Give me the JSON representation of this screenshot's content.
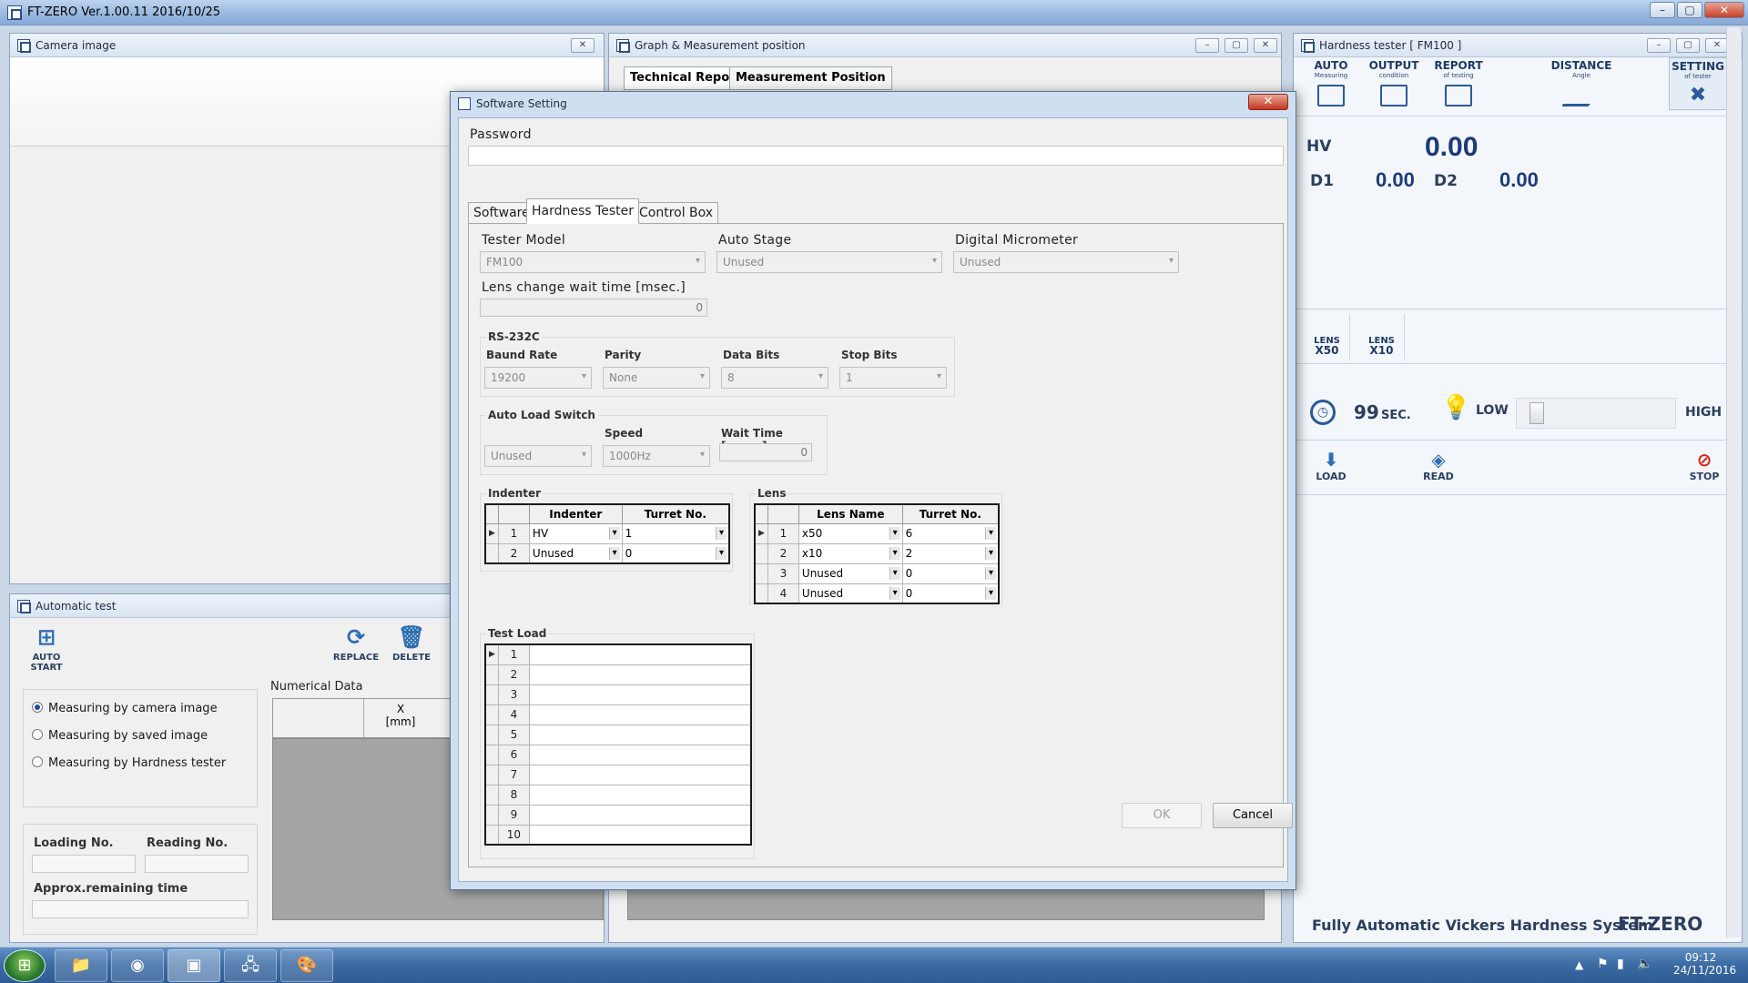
{
  "window": {
    "title": "FT-ZERO Ver.1.00.11  2016/10/25"
  },
  "camera_panel": {
    "title": "Camera image"
  },
  "auto_panel": {
    "title": "Automatic test",
    "buttons": {
      "auto_start": "AUTO\nSTART",
      "replace": "REPLACE",
      "delete": "DELETE"
    },
    "auto_start_line1": "AUTO",
    "auto_start_line2": "START",
    "modes": [
      "Measuring by camera image",
      "Measuring by saved image",
      "Measuring by Hardness tester"
    ],
    "loading_no": "Loading No.",
    "reading_no": "Reading No.",
    "remaining_time": "Approx.remaining time",
    "numerical_data": "Numerical Data",
    "col_x": "X",
    "col_x_unit": "[mm]"
  },
  "graph_panel": {
    "title": "Graph & Measurement position",
    "tabs": [
      "Technical Report",
      "Measurement Position"
    ]
  },
  "hardness_panel": {
    "title": "Hardness tester [ FM100 ]",
    "buttons": [
      {
        "main": "AUTO",
        "sub": "Measuring"
      },
      {
        "main": "OUTPUT",
        "sub": "condition"
      },
      {
        "main": "REPORT",
        "sub": "of testing"
      },
      {
        "main": "DISTANCE",
        "sub": "Angle"
      },
      {
        "main": "SETTING",
        "sub": "of tester"
      }
    ],
    "hv_label": "HV",
    "hv_value": "0.00",
    "d1_label": "D1",
    "d1_value": "0.00",
    "d2_label": "D2",
    "d2_value": "0.00",
    "lenses": [
      {
        "top": "LENS",
        "bottom": "X50"
      },
      {
        "top": "LENS",
        "bottom": "X10"
      }
    ],
    "timer_value": "99",
    "timer_unit": "SEC.",
    "light_low": "LOW",
    "light_high": "HIGH",
    "actions": {
      "load": "LOAD",
      "read": "READ",
      "stop": "STOP"
    },
    "footer": "Fully Automatic Vickers Hardness System",
    "brand": "FT-ZERO"
  },
  "dialog": {
    "title": "Software Setting",
    "password_label": "Password",
    "password_value": "",
    "tabs": [
      "Software",
      "Hardness Tester",
      "Control Box"
    ],
    "tester_model_label": "Tester Model",
    "tester_model": "FM100",
    "auto_stage_label": "Auto Stage",
    "auto_stage": "Unused",
    "micrometer_label": "Digital Micrometer",
    "micrometer": "Unused",
    "lens_wait_label": "Lens change wait time [msec.]",
    "lens_wait_value": "0",
    "rs232c": {
      "legend": "RS-232C",
      "baud_label": "Baund Rate",
      "baud": "19200",
      "parity_label": "Parity",
      "parity": "None",
      "databits_label": "Data Bits",
      "databits": "8",
      "stopbits_label": "Stop Bits",
      "stopbits": "1"
    },
    "auto_load": {
      "legend": "Auto Load Switch",
      "value": "Unused",
      "speed_label": "Speed",
      "speed": "1000Hz",
      "wait_label": "Wait Time [msec.]",
      "wait": "0"
    },
    "indenter": {
      "legend": "Indenter",
      "headers": [
        "Indenter",
        "Turret No."
      ],
      "rows": [
        {
          "no": "1",
          "name": "HV",
          "turret": "1"
        },
        {
          "no": "2",
          "name": "Unused",
          "turret": "0"
        }
      ]
    },
    "lens": {
      "legend": "Lens",
      "headers": [
        "Lens Name",
        "Turret No."
      ],
      "rows": [
        {
          "no": "1",
          "name": "x50",
          "turret": "6"
        },
        {
          "no": "2",
          "name": "x10",
          "turret": "2"
        },
        {
          "no": "3",
          "name": "Unused",
          "turret": "0"
        },
        {
          "no": "4",
          "name": "Unused",
          "turret": "0"
        }
      ]
    },
    "test_load": {
      "legend": "Test Load",
      "rows": [
        "1",
        "2",
        "3",
        "4",
        "5",
        "6",
        "7",
        "8",
        "9",
        "10"
      ]
    },
    "ok_label": "OK",
    "cancel_label": "Cancel"
  },
  "taskbar": {
    "time": "09:12",
    "date": "24/11/2016"
  }
}
